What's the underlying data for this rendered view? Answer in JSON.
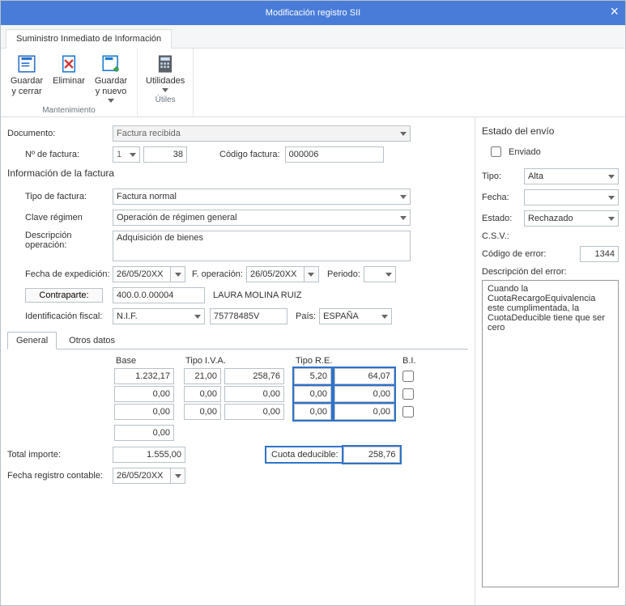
{
  "title": "Modificación registro SII",
  "ribbon_tab": "Suministro Inmediato de Información",
  "ribbon": {
    "group1_label": "Mantenimiento",
    "group2_label": "Útiles",
    "btn_save_close": "Guardar\ny cerrar",
    "btn_delete": "Eliminar",
    "btn_save_new": "Guardar\ny nuevo",
    "btn_utilities": "Utilidades"
  },
  "form": {
    "documento_label": "Documento:",
    "documento_value": "Factura recibida",
    "num_factura_label": "Nº de factura:",
    "num_factura_serie": "1",
    "num_factura_num": "38",
    "codigo_factura_label": "Código factura:",
    "codigo_factura_value": "000006",
    "info_factura_label": "Información de la factura",
    "tipo_factura_label": "Tipo de factura:",
    "tipo_factura_value": "Factura normal",
    "clave_regimen_label": "Clave régimen",
    "clave_regimen_value": "Operación de régimen general",
    "desc_op_label": "Descripción operación:",
    "desc_op_value": "Adquisición de bienes",
    "fecha_exp_label": "Fecha de expedición:",
    "fecha_exp_value": "26/05/20XX",
    "f_operacion_label": "F. operación:",
    "f_operacion_value": "26/05/20XX",
    "periodo_label": "Periodo:",
    "periodo_value": "",
    "contraparte_btn": "Contraparte:",
    "contraparte_cuenta": "400.0.0.00004",
    "contraparte_nombre": "LAURA MOLINA RUIZ",
    "id_fiscal_label": "Identificación fiscal:",
    "id_fiscal_tipo": "N.I.F.",
    "id_fiscal_valor": "75778485V",
    "pais_label": "País:",
    "pais_value": "ESPAÑA"
  },
  "tabs": {
    "general": "General",
    "otros": "Otros datos"
  },
  "grid": {
    "headers": {
      "base": "Base",
      "tipo_iva": "Tipo I.V.A.",
      "tipo_re": "Tipo R.E.",
      "bi": "B.I."
    },
    "rows": [
      {
        "base": "1.232,17",
        "iva_pct": "21,00",
        "iva_cuota": "258,76",
        "re_pct": "5,20",
        "re_cuota": "64,07",
        "bi": false
      },
      {
        "base": "0,00",
        "iva_pct": "0,00",
        "iva_cuota": "0,00",
        "re_pct": "0,00",
        "re_cuota": "0,00",
        "bi": false
      },
      {
        "base": "0,00",
        "iva_pct": "0,00",
        "iva_cuota": "0,00",
        "re_pct": "0,00",
        "re_cuota": "0,00",
        "bi": false
      }
    ],
    "extra_base": "0,00",
    "total_label": "Total importe:",
    "total_value": "1.555,00",
    "cuota_ded_label": "Cuota deducible:",
    "cuota_ded_value": "258,76",
    "fecha_reg_label": "Fecha registro contable:",
    "fecha_reg_value": "26/05/20XX"
  },
  "envio": {
    "section": "Estado del envío",
    "enviado_label": "Enviado",
    "enviado_checked": false,
    "tipo_label": "Tipo:",
    "tipo_value": "Alta",
    "fecha_label": "Fecha:",
    "fecha_value": "",
    "estado_label": "Estado:",
    "estado_value": "Rechazado",
    "csv_label": "C.S.V.:",
    "cod_error_label": "Código de error:",
    "cod_error_value": "1344",
    "desc_error_label": "Descripción del error:",
    "desc_error_value": "Cuando la CuotaRecargoEquivalencia este cumplimentada, la CuotaDeducible tiene que ser cero"
  }
}
